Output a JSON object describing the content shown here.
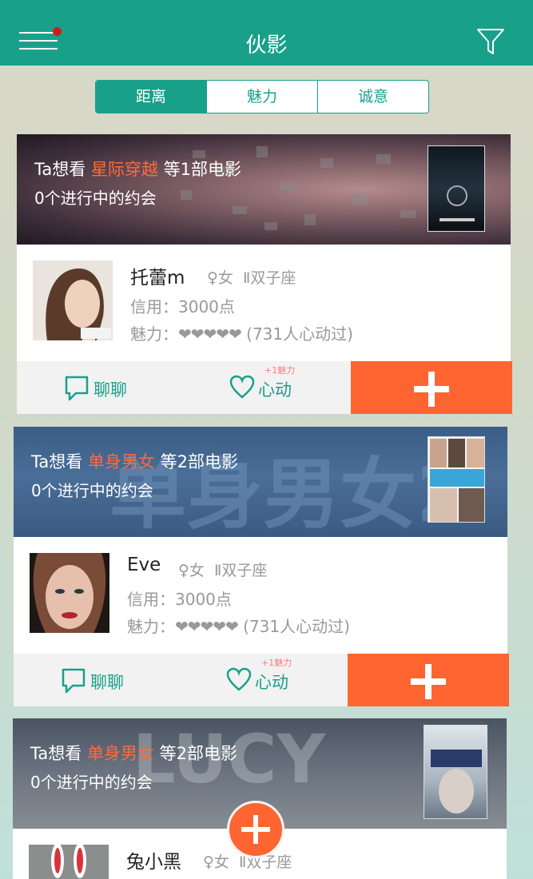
{
  "header": {
    "title": "伙影",
    "menu_icon": "menu-icon",
    "filter_icon": "filter-icon",
    "brand_color": "#19a08b"
  },
  "tabs": [
    {
      "label": "距离",
      "active": true
    },
    {
      "label": "魅力",
      "active": false
    },
    {
      "label": "诚意",
      "active": false
    }
  ],
  "cards": [
    {
      "want_prefix": "Ta想看 ",
      "movie": "星际穿越",
      "want_suffix": " 等1部电影",
      "dates": "0个进行中的约会",
      "user": {
        "name": "托蕾m",
        "gender": "♀女",
        "zodiac": "Ⅱ双子座",
        "credit": "信用：3000点",
        "charm_label": "魅力：",
        "hearts": "❤❤❤❤❤",
        "charm_count": " (731人心动过)"
      },
      "actions": {
        "chat": "聊聊",
        "like": "心动",
        "like_bonus": "+1魅力"
      }
    },
    {
      "want_prefix": "Ta想看 ",
      "movie": "单身男女",
      "want_suffix": " 等2部电影",
      "dates": "0个进行中的约会",
      "user": {
        "name": "Eve",
        "gender": "♀女",
        "zodiac": "Ⅱ双子座",
        "credit": "信用：3000点",
        "charm_label": "魅力：",
        "hearts": "❤❤❤❤❤",
        "charm_count": " (731人心动过)"
      },
      "actions": {
        "chat": "聊聊",
        "like": "心动",
        "like_bonus": "+1魅力"
      }
    },
    {
      "want_prefix": "Ta想看 ",
      "movie": "单身男女",
      "want_suffix": " 等2部电影",
      "dates": "0个进行中的约会",
      "user": {
        "name": "兔小黑",
        "gender": "♀女",
        "zodiac": "Ⅱ双子座"
      }
    }
  ],
  "colors": {
    "accent": "#19a08b",
    "action": "#ff6530",
    "highlight": "#ff6a3a",
    "muted": "#999999"
  }
}
